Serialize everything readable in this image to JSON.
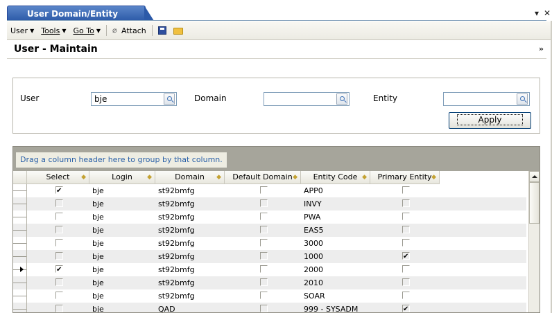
{
  "window": {
    "tab_title": "User Domain/Entity Access...",
    "pin_glyph": "▾",
    "close_glyph": "✕"
  },
  "toolbar": {
    "user": "User",
    "tools": "Tools",
    "goto": "Go To",
    "attach": "Attach"
  },
  "section": {
    "title": "User - Maintain",
    "collapse_glyph": "»"
  },
  "filters": {
    "user_label": "User",
    "user_value": "bje",
    "domain_label": "Domain",
    "domain_value": "",
    "entity_label": "Entity",
    "entity_value": "",
    "apply_label": "Apply"
  },
  "grid": {
    "group_hint": "Drag a column header here to group by that column.",
    "columns": [
      "Select",
      "Login",
      "Domain",
      "Default Domain",
      "Entity Code",
      "Primary Entity"
    ],
    "rows": [
      {
        "select": true,
        "login": "bje",
        "domain": "st92bmfg",
        "default_domain": false,
        "entity_code": "APP0",
        "primary_entity": false,
        "current": false
      },
      {
        "select": false,
        "login": "bje",
        "domain": "st92bmfg",
        "default_domain": false,
        "entity_code": "INVY",
        "primary_entity": false,
        "current": false
      },
      {
        "select": false,
        "login": "bje",
        "domain": "st92bmfg",
        "default_domain": false,
        "entity_code": "PWA",
        "primary_entity": false,
        "current": false
      },
      {
        "select": false,
        "login": "bje",
        "domain": "st92bmfg",
        "default_domain": false,
        "entity_code": "EAS5",
        "primary_entity": false,
        "current": false
      },
      {
        "select": false,
        "login": "bje",
        "domain": "st92bmfg",
        "default_domain": false,
        "entity_code": "3000",
        "primary_entity": false,
        "current": false
      },
      {
        "select": false,
        "login": "bje",
        "domain": "st92bmfg",
        "default_domain": false,
        "entity_code": "1000",
        "primary_entity": true,
        "current": false
      },
      {
        "select": true,
        "login": "bje",
        "domain": "st92bmfg",
        "default_domain": false,
        "entity_code": "2000",
        "primary_entity": false,
        "current": true
      },
      {
        "select": false,
        "login": "bje",
        "domain": "st92bmfg",
        "default_domain": false,
        "entity_code": "2010",
        "primary_entity": false,
        "current": false
      },
      {
        "select": false,
        "login": "bje",
        "domain": "st92bmfg",
        "default_domain": false,
        "entity_code": "SOAR",
        "primary_entity": false,
        "current": false
      },
      {
        "select": false,
        "login": "bje",
        "domain": "QAD",
        "default_domain": false,
        "entity_code": "999 - SYSADM",
        "primary_entity": true,
        "current": false
      }
    ]
  }
}
